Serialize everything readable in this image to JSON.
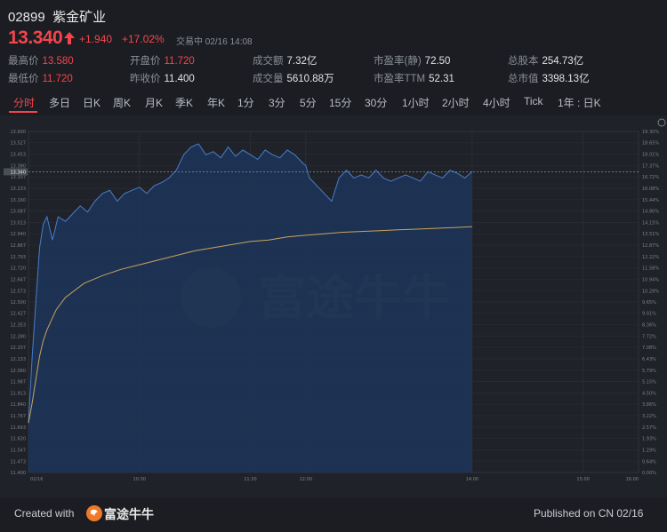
{
  "header": {
    "code": "02899",
    "name": "紫金矿业",
    "price": "13.340",
    "change": "+1.940",
    "change_pct": "+17.02%",
    "status": "交易中 02/16 14:08"
  },
  "stats": [
    {
      "label": "最高价",
      "value": "13.580",
      "color": "red"
    },
    {
      "label": "开盘价",
      "value": "11.720",
      "color": "red"
    },
    {
      "label": "成交额",
      "value": "7.32亿",
      "color": "white"
    },
    {
      "label": "市盈率(静)",
      "value": "72.50",
      "color": "white"
    },
    {
      "label": "总股本",
      "value": "254.73亿",
      "color": "white"
    },
    {
      "label": "最低价",
      "value": "11.720",
      "color": "red"
    },
    {
      "label": "昨收价",
      "value": "11.400",
      "color": "white"
    },
    {
      "label": "成交量",
      "value": "5610.88万",
      "color": "white"
    },
    {
      "label": "市盈率TTM",
      "value": "52.31",
      "color": "white"
    },
    {
      "label": "总市值",
      "value": "3398.13亿",
      "color": "white"
    }
  ],
  "tabs": [
    "分时",
    "多日",
    "日K",
    "周K",
    "月K",
    "季K",
    "年K",
    "1分",
    "3分",
    "5分",
    "15分",
    "30分",
    "1小时",
    "2小时",
    "4小时",
    "Tick",
    "1年 : 日K"
  ],
  "active_tab": "分时",
  "watermark": "富途牛牛",
  "footer": {
    "created": "Created with",
    "brand": "富途牛牛",
    "published": "Published on CN 02/16"
  },
  "colors": {
    "up": "#f5444b",
    "price_line": "#4a7cc9",
    "area_fill": "#1d3559",
    "avg_line": "#c9a45c"
  },
  "chart_data": {
    "type": "line",
    "title": "",
    "prev_close": 11.4,
    "current": 13.34,
    "ylim": [
      11.4,
      13.6
    ],
    "y_ticks": [
      13.6,
      13.527,
      13.453,
      13.38,
      13.307,
      13.233,
      13.16,
      13.087,
      13.013,
      12.94,
      12.867,
      12.793,
      12.72,
      12.647,
      12.573,
      12.5,
      12.427,
      12.353,
      12.28,
      12.207,
      12.133,
      12.06,
      11.987,
      11.913,
      11.84,
      11.767,
      11.693,
      11.62,
      11.547,
      11.473,
      11.4
    ],
    "y_ticks_right": [
      "19.30%",
      "18.65%",
      "18.01%",
      "17.37%",
      "16.72%",
      "16.08%",
      "15.44%",
      "14.80%",
      "14.15%",
      "13.51%",
      "12.87%",
      "12.22%",
      "11.58%",
      "10.94%",
      "10.29%",
      "9.65%",
      "9.01%",
      "8.36%",
      "7.72%",
      "7.08%",
      "6.43%",
      "5.79%",
      "5.15%",
      "4.50%",
      "3.86%",
      "3.22%",
      "2.57%",
      "1.93%",
      "1.29%",
      "0.64%",
      "0.00%"
    ],
    "x_labels": [
      "02/16",
      "10:30",
      "11:30",
      "12:00",
      "14:00",
      "15:00",
      "16:00"
    ],
    "x_label_pos": [
      0,
      60,
      120,
      150,
      240,
      300,
      330
    ],
    "total_minutes": 330,
    "price_series": {
      "x": [
        0,
        2,
        4,
        6,
        8,
        10,
        13,
        16,
        20,
        24,
        28,
        32,
        36,
        40,
        44,
        48,
        52,
        56,
        60,
        64,
        68,
        72,
        76,
        80,
        84,
        88,
        92,
        96,
        100,
        104,
        108,
        112,
        116,
        120,
        124,
        128,
        132,
        136,
        140,
        144,
        148,
        150,
        152,
        156,
        160,
        164,
        168,
        172,
        176,
        180,
        184,
        188,
        192,
        196,
        200,
        204,
        208,
        212,
        216,
        220,
        224,
        228,
        232,
        236,
        240
      ],
      "values": [
        11.72,
        12.15,
        12.5,
        12.85,
        13.0,
        13.05,
        12.9,
        13.05,
        13.02,
        13.07,
        13.12,
        13.08,
        13.15,
        13.2,
        13.22,
        13.15,
        13.2,
        13.22,
        13.24,
        13.2,
        13.25,
        13.27,
        13.3,
        13.35,
        13.45,
        13.5,
        13.52,
        13.45,
        13.47,
        13.43,
        13.5,
        13.44,
        13.48,
        13.45,
        13.42,
        13.48,
        13.45,
        13.43,
        13.48,
        13.45,
        13.4,
        13.38,
        13.3,
        13.25,
        13.2,
        13.15,
        13.3,
        13.35,
        13.3,
        13.32,
        13.3,
        13.35,
        13.3,
        13.28,
        13.3,
        13.32,
        13.3,
        13.28,
        13.34,
        13.32,
        13.3,
        13.35,
        13.33,
        13.3,
        13.34
      ]
    },
    "avg_series": {
      "x": [
        0,
        2,
        4,
        6,
        8,
        10,
        15,
        20,
        30,
        40,
        50,
        60,
        70,
        80,
        90,
        100,
        110,
        120,
        130,
        140,
        150,
        160,
        170,
        180,
        190,
        200,
        210,
        220,
        230,
        240
      ],
      "values": [
        11.72,
        11.85,
        12.0,
        12.15,
        12.25,
        12.32,
        12.45,
        12.53,
        12.62,
        12.67,
        12.71,
        12.74,
        12.77,
        12.8,
        12.83,
        12.85,
        12.87,
        12.89,
        12.9,
        12.92,
        12.93,
        12.94,
        12.95,
        12.955,
        12.96,
        12.965,
        12.97,
        12.975,
        12.98,
        12.985
      ]
    }
  }
}
